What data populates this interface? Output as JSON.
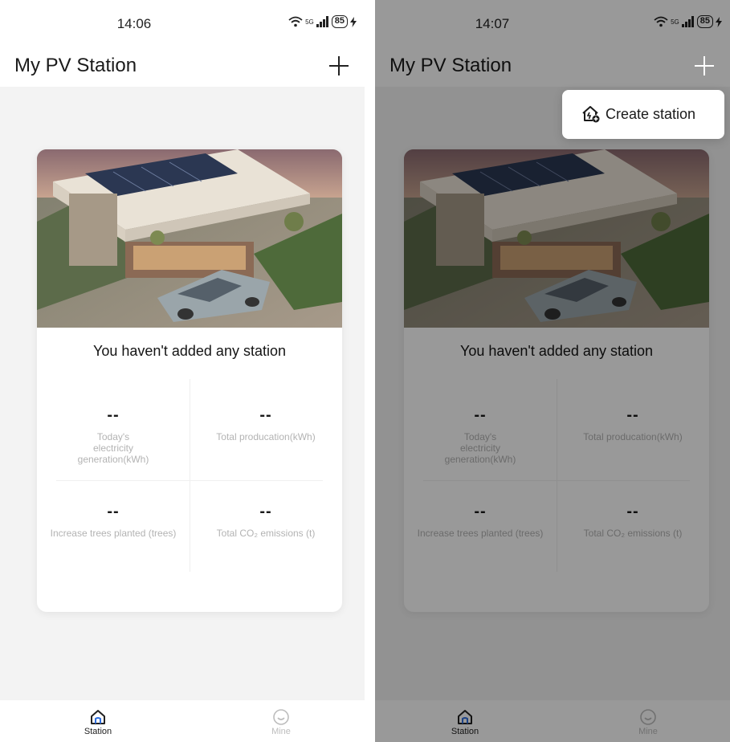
{
  "left": {
    "status": {
      "time": "14:06",
      "network": "5G",
      "battery": "85"
    },
    "title": "My PV Station",
    "empty_message": "You haven't added any station",
    "stats": [
      {
        "value": "--",
        "label": "Today's electricity generation(kWh)"
      },
      {
        "value": "--",
        "label": "Total producation(kWh)"
      },
      {
        "value": "--",
        "label": "Increase trees planted (trees)"
      },
      {
        "value": "--",
        "label": "Total CO₂ emissions (t)"
      }
    ],
    "tabs": [
      {
        "label": "Station"
      },
      {
        "label": "Mine"
      }
    ]
  },
  "right": {
    "status": {
      "time": "14:07",
      "network": "5G",
      "battery": "85"
    },
    "title": "My PV Station",
    "empty_message": "You haven't added any station",
    "stats": [
      {
        "value": "--",
        "label": "Today's electricity generation(kWh)"
      },
      {
        "value": "--",
        "label": "Total producation(kWh)"
      },
      {
        "value": "--",
        "label": "Increase trees planted (trees)"
      },
      {
        "value": "--",
        "label": "Total CO₂ emissions (t)"
      }
    ],
    "tabs": [
      {
        "label": "Station"
      },
      {
        "label": "Mine"
      }
    ],
    "popup": {
      "label": "Create station",
      "icon": "home-plus-icon"
    }
  },
  "colors": {
    "background": "#f3f3f3",
    "card": "#ffffff",
    "muted_label": "#b3b3b3",
    "dim_overlay": "rgba(0,0,0,0.4)"
  }
}
